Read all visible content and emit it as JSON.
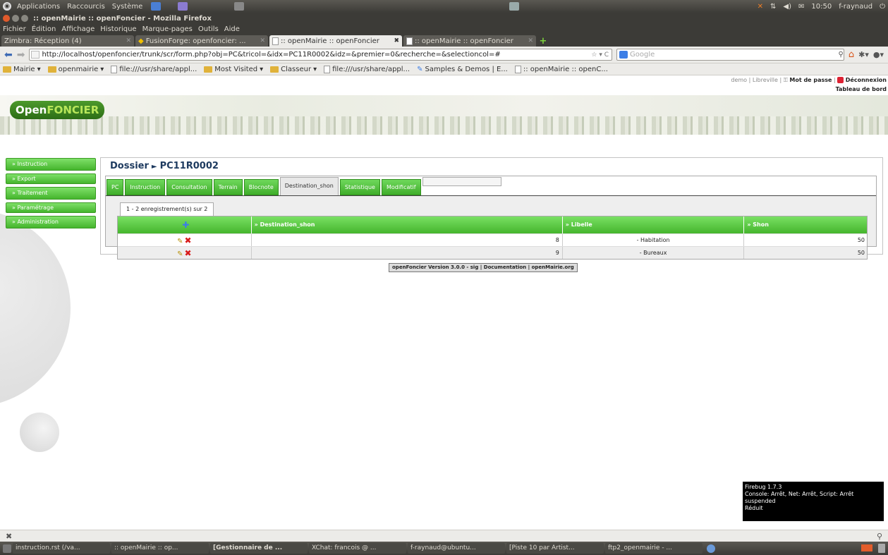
{
  "top_panel": {
    "menus": [
      "Applications",
      "Raccourcis",
      "Système"
    ],
    "clock": "10:50",
    "user": "f-raynaud"
  },
  "window": {
    "title": ":: openMairie :: openFoncier - Mozilla Firefox"
  },
  "menubar": [
    "Fichier",
    "Édition",
    "Affichage",
    "Historique",
    "Marque-pages",
    "Outils",
    "Aide"
  ],
  "browser_tabs": [
    {
      "label": "Zimbra: Réception (4)"
    },
    {
      "label": "FusionForge: openfoncier: ..."
    },
    {
      "label": ":: openMairie :: openFoncier"
    },
    {
      "label": ":: openMairie :: openFoncier"
    }
  ],
  "navbar": {
    "url": "http://localhost/openfoncier/trunk/scr/form.php?obj=PC&tricol=&idx=PC11R0002&idz=&premier=0&recherche=&selectioncol=#",
    "search_placeholder": "Google"
  },
  "bookmarks": [
    "Mairie",
    "openmairie",
    "file:///usr/share/appl...",
    "Most Visited",
    "Classeur",
    "file:///usr/share/appl...",
    "Samples & Demos | E...",
    ":: openMairie :: openC..."
  ],
  "app": {
    "logo_prefix": "Open",
    "logo_suffix": "FONCIER",
    "top_links": {
      "user": "demo",
      "city": "Libreville",
      "password": "Mot de passe",
      "logout": "Déconnexion"
    },
    "dashboard_link": "Tableau de bord",
    "left_menu": [
      "» Instruction",
      "» Export",
      "» Traitement",
      "» Paramétrage",
      "» Administration"
    ],
    "dossier_label": "Dossier",
    "dossier_id": "PC11R0002",
    "tabs": [
      "PC",
      "Instruction",
      "Consultation",
      "Terrain",
      "Blocnote",
      "Destination_shon",
      "Statistique",
      "Modificatif"
    ],
    "subtab": "1 - 2 enregistrement(s) sur 2",
    "grid": {
      "headers": [
        "» Destination_shon",
        "» Libelle",
        "» Shon"
      ],
      "rows": [
        {
          "destination": "8",
          "libelle": "- Habitation",
          "shon": "50"
        },
        {
          "destination": "9",
          "libelle": "- Bureaux",
          "shon": "50"
        }
      ]
    },
    "footer": {
      "version": "openFoncier Version 3.0.0 - sig",
      "doc": "Documentation",
      "site": "openMairie.org"
    }
  },
  "firebug": {
    "line1": "Firebug 1.7.3",
    "line2": "Console: Arrêt, Net: Arrêt, Script: Arrêt",
    "line3": "suspended",
    "line4": "Réduit"
  },
  "taskbar": [
    "instruction.rst (/va...",
    ":: openMairie :: op...",
    "[Gestionnaire de ...",
    "XChat: francois @ ...",
    "f-raynaud@ubuntu...",
    "[Piste 10 par Artist...",
    "ftp2_openmairie - ..."
  ]
}
